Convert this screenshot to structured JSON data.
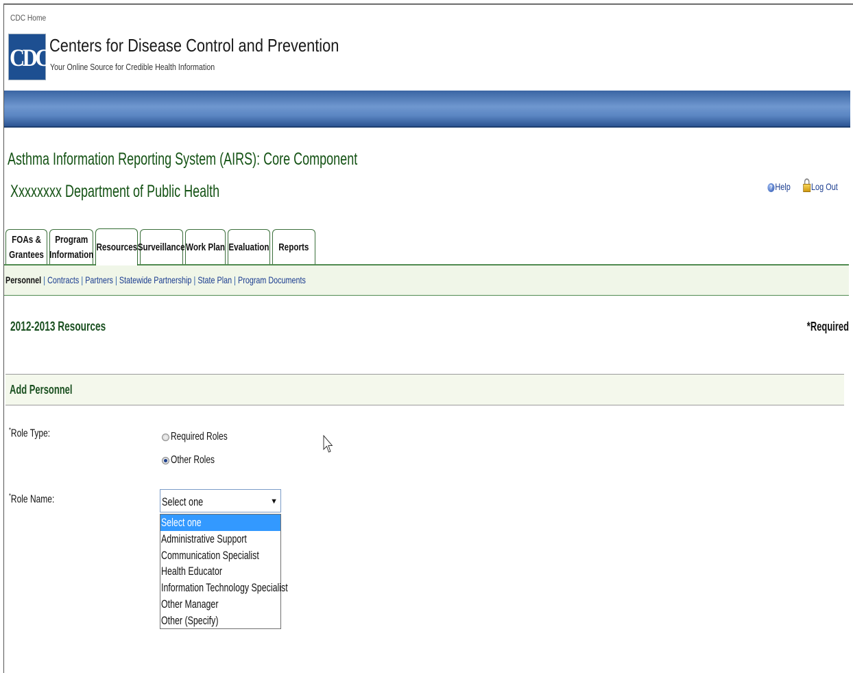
{
  "header": {
    "home_link": "CDC Home",
    "logo_text": "CDC",
    "org_name": "Centers for Disease Control and Prevention",
    "tagline": "Your Online Source for Credible Health Information"
  },
  "app": {
    "title": "Asthma Information Reporting System (AIRS): Core Component",
    "department": "Xxxxxxxx Department of Public Health"
  },
  "toplinks": {
    "help": "Help",
    "logout": "Log Out"
  },
  "tabs": [
    {
      "line1": "FOAs &",
      "line2": "Grantees"
    },
    {
      "line1": "Program",
      "line2": "Information"
    },
    {
      "line1": "Resources",
      "line2": ""
    },
    {
      "line1": "Surveillance",
      "line2": ""
    },
    {
      "line1": "Work Plan",
      "line2": ""
    },
    {
      "line1": "Evaluation",
      "line2": ""
    },
    {
      "line1": "Reports",
      "line2": ""
    }
  ],
  "active_tab": "Resources",
  "subnav": {
    "current": "Personnel",
    "links": [
      "Contracts",
      "Partners",
      "Statewide Partnership",
      "State Plan",
      "Program Documents"
    ]
  },
  "page": {
    "section_title": "2012-2013 Resources",
    "required_note": "*Required",
    "panel_title": "Add Personnel"
  },
  "form": {
    "role_type": {
      "label": "Role Type:",
      "options": [
        "Required Roles",
        "Other Roles"
      ],
      "selected": "Other Roles"
    },
    "role_name": {
      "label": "Role Name:",
      "value": "Select one",
      "options": [
        "Select one",
        "Administrative Support",
        "Communication Specialist",
        "Health Educator",
        "Information Technology Specialist",
        "Other Manager",
        "Other (Specify)"
      ]
    }
  },
  "colors": {
    "brand_blue": "#1d4f91",
    "title_green": "#145214",
    "link_blue": "#1a3c8f",
    "highlight": "#3399ff"
  }
}
